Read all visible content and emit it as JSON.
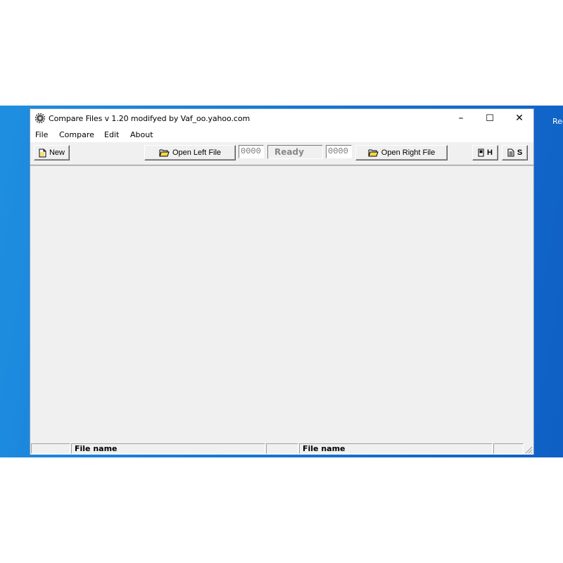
{
  "window": {
    "title": "Compare Files   v 1.20    modifyed by Vaf_oo.yahoo.com",
    "controls": {
      "minimize": "–",
      "maximize": "☐",
      "close": "✕"
    }
  },
  "desktop": {
    "edge_text": "Rec"
  },
  "menu": {
    "items": [
      "File",
      "Compare",
      "Edit",
      "About"
    ]
  },
  "toolbar": {
    "new_label": "New",
    "open_left_label": "Open Left File",
    "left_counter": "0000",
    "status": "Ready",
    "right_counter": "0000",
    "open_right_label": "Open Right File",
    "h_label": "H",
    "s_label": "S"
  },
  "statusbar": {
    "left_file_label": "File name",
    "right_file_label": "File name"
  },
  "colors": {
    "desktop": "#1778d6",
    "window_bg": "#f0f0f0",
    "folder_yellow": "#f5d64a"
  }
}
